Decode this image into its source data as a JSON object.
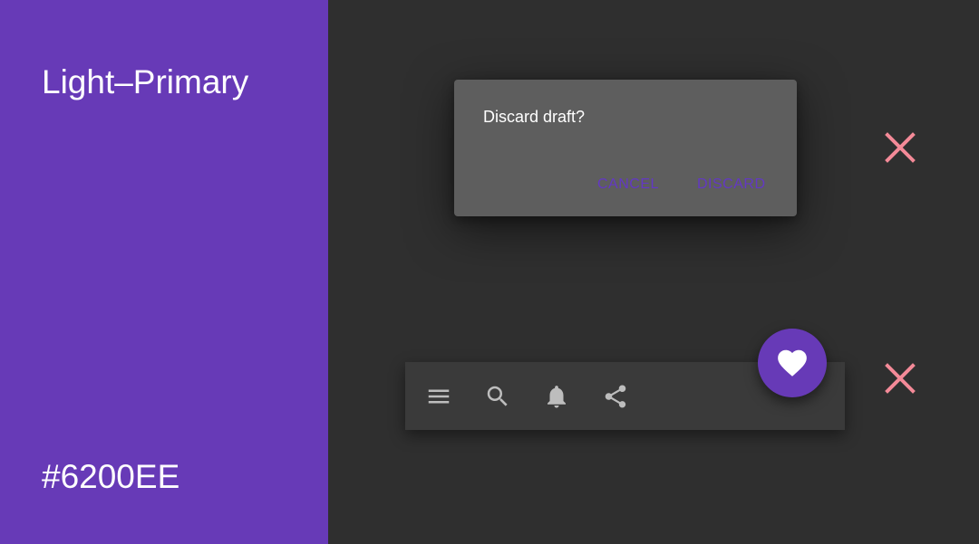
{
  "swatch": {
    "name": "Light–Primary",
    "hex": "#6200EE",
    "panel_color": "#673ab7"
  },
  "dialog": {
    "title": "Discard draft?",
    "cancel_label": "CANCEL",
    "discard_label": "DISCARD",
    "action_color": "#6338c4"
  },
  "bottom_app_bar": {
    "icons": [
      "menu-icon",
      "search-icon",
      "bell-icon",
      "share-icon"
    ],
    "fab_icon": "heart-icon"
  },
  "verdicts": {
    "dialog": "x-mark-icon",
    "bottom_app_bar": "x-mark-icon",
    "color": "#f48a98"
  }
}
